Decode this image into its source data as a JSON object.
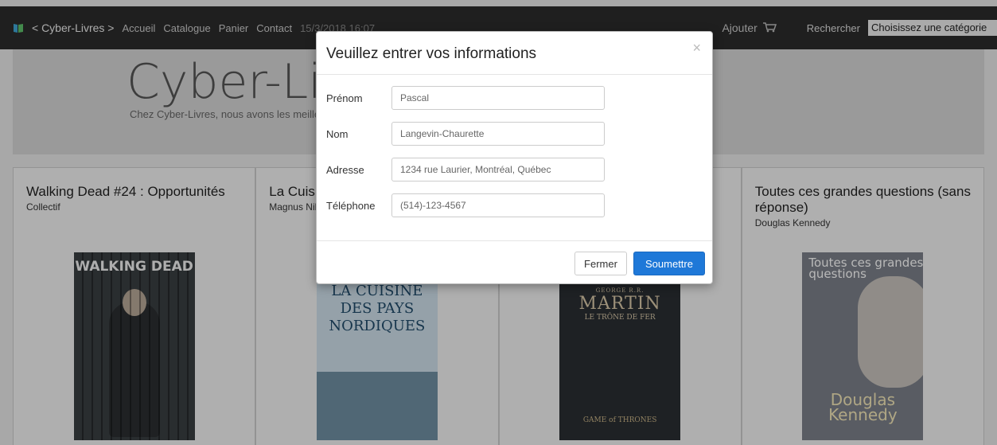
{
  "navbar": {
    "brand_icon": "book-icon",
    "brand": "< Cyber-Livres >",
    "links": [
      "Accueil",
      "Catalogue",
      "Panier",
      "Contact"
    ],
    "datetime": "15/3/2018 16:07",
    "add_cart_label": "Ajouter",
    "cart_icon": "cart-icon",
    "search_label": "Rechercher",
    "category_select": "Choisissez une catégorie"
  },
  "jumbotron": {
    "title": "Cyber-Livres",
    "text": "Chez Cyber-Livres, nous avons les meilleurs livres au meilleur prix. Pour vous inspirer, voici une sélection de nos nouveautés :"
  },
  "books": [
    {
      "title": "Walking Dead #24 : Opportunités",
      "author": "Collectif",
      "cover_text": "WALKING DEAD"
    },
    {
      "title": "La Cuisine des pays nordiques",
      "author": "Magnus Nilsson",
      "cover_text": "LA CUISINE DES PAYS NORDIQUES"
    },
    {
      "title": "",
      "author": "",
      "cover_top": "GEORGE R.R.",
      "cover_name": "MARTIN",
      "cover_sub": "LE TRÔNE DE FER",
      "cover_bottom": "GAME of THRONES"
    },
    {
      "title": "Toutes ces grandes questions (sans réponse)",
      "author": "Douglas Kennedy",
      "cover_text": "Toutes ces grandes questions",
      "cover_author": "Douglas Kennedy"
    }
  ],
  "modal": {
    "title": "Veuillez entrer vos informations",
    "close_symbol": "×",
    "fields": [
      {
        "label": "Prénom",
        "value": "Pascal"
      },
      {
        "label": "Nom",
        "value": "Langevin-Chaurette"
      },
      {
        "label": "Adresse",
        "value": "1234 rue Laurier, Montréal, Québec"
      },
      {
        "label": "Téléphone",
        "value": "(514)-123-4567"
      }
    ],
    "close_button": "Fermer",
    "submit_button": "Soumettre"
  },
  "colors": {
    "navbar": "#2b2b2b",
    "primary_button": "#1e78d8"
  }
}
